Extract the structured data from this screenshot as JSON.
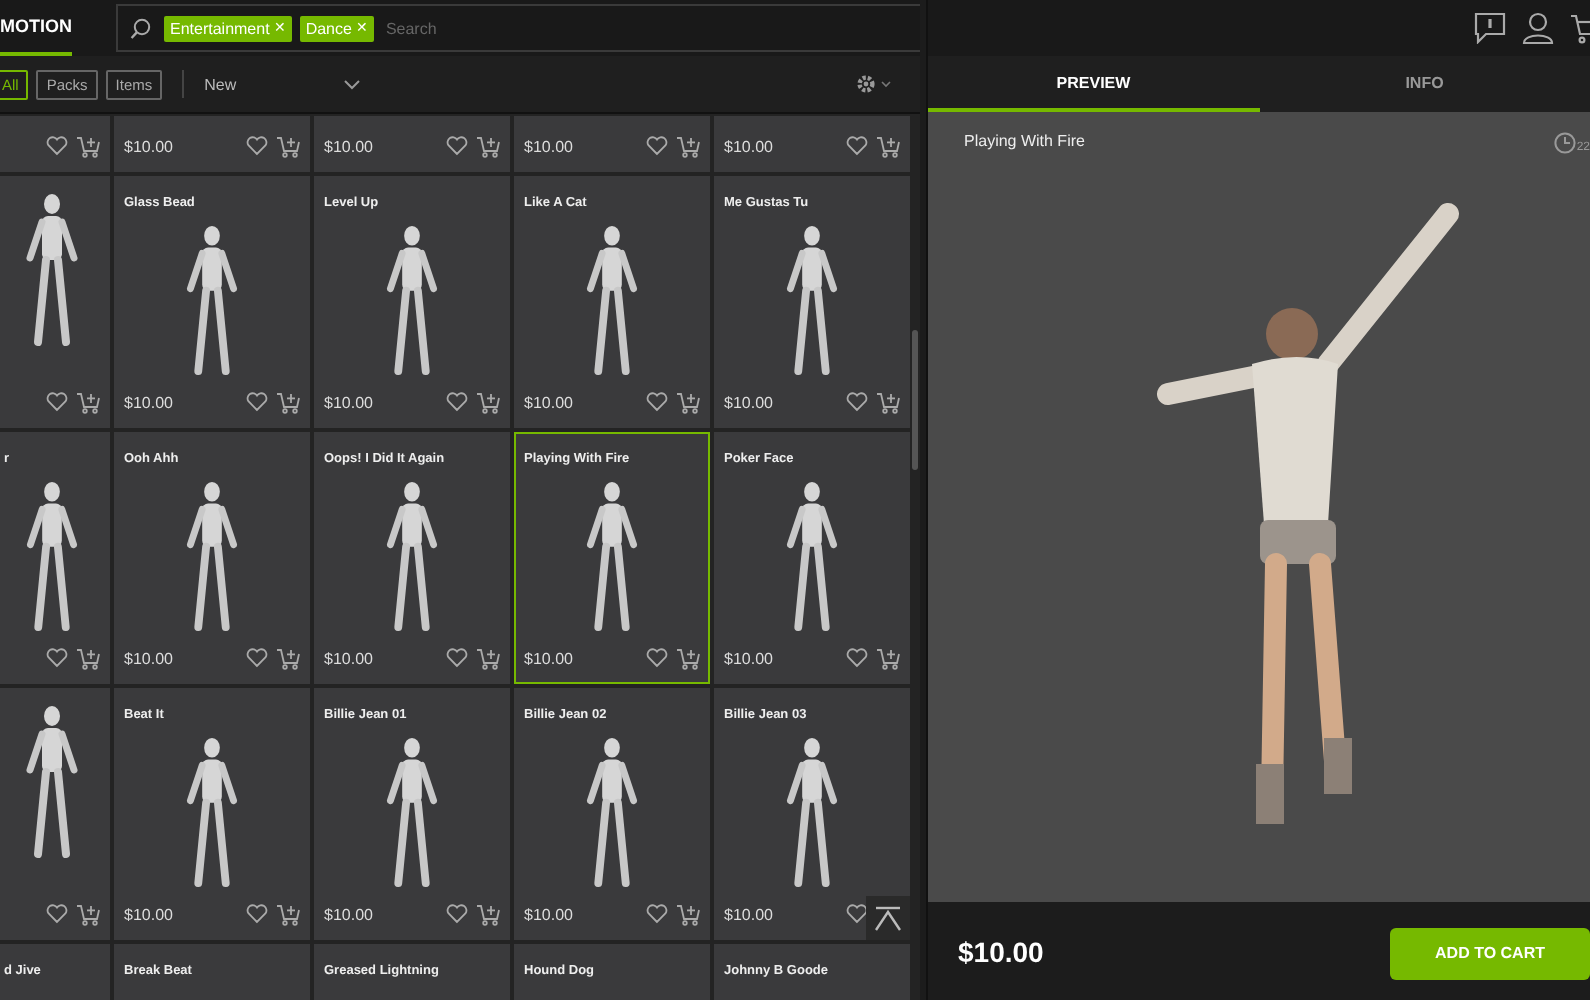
{
  "header": {
    "app_tab": "MOTION",
    "search": {
      "chips": [
        {
          "label": "Entertainment",
          "remove": "✕"
        },
        {
          "label": "Dance",
          "remove": "✕"
        }
      ],
      "placeholder": "Search"
    }
  },
  "toolbar": {
    "filters": [
      {
        "label": "All",
        "selected": true
      },
      {
        "label": "Packs",
        "selected": false
      },
      {
        "label": "Items",
        "selected": false
      }
    ],
    "sort": "New"
  },
  "grid": {
    "rows": [
      [
        {
          "selected": false
        },
        {
          "price": "$10.00",
          "selected": false
        },
        {
          "price": "$10.00",
          "selected": false
        },
        {
          "price": "$10.00",
          "selected": false
        },
        {
          "price": "$10.00",
          "selected": false
        }
      ],
      [
        {
          "selected": false
        },
        {
          "name": "Glass Bead",
          "price": "$10.00",
          "selected": false
        },
        {
          "name": "Level Up",
          "price": "$10.00",
          "selected": false
        },
        {
          "name": "Like A Cat",
          "price": "$10.00",
          "selected": false
        },
        {
          "name": "Me Gustas Tu",
          "price": "$10.00",
          "selected": false
        }
      ],
      [
        {
          "name": "r",
          "selected": false
        },
        {
          "name": "Ooh Ahh",
          "price": "$10.00",
          "selected": false
        },
        {
          "name": "Oops! I Did It Again",
          "price": "$10.00",
          "selected": false
        },
        {
          "name": "Playing With Fire",
          "price": "$10.00",
          "selected": true
        },
        {
          "name": "Poker Face",
          "price": "$10.00",
          "selected": false
        }
      ],
      [
        {
          "selected": false
        },
        {
          "name": "Beat It",
          "price": "$10.00",
          "selected": false
        },
        {
          "name": "Billie Jean 01",
          "price": "$10.00",
          "selected": false
        },
        {
          "name": "Billie Jean 02",
          "price": "$10.00",
          "selected": false
        },
        {
          "name": "Billie Jean 03",
          "price": "$10.00",
          "selected": false
        }
      ],
      [
        {
          "name": "d Jive",
          "selected": false
        },
        {
          "name": "Break Beat",
          "selected": false
        },
        {
          "name": "Greased Lightning",
          "selected": false
        },
        {
          "name": "Hound Dog",
          "selected": false
        },
        {
          "name": "Johnny B Goode",
          "selected": false
        }
      ]
    ]
  },
  "panel": {
    "tabs": [
      {
        "label": "PREVIEW",
        "selected": true
      },
      {
        "label": "INFO",
        "selected": false
      }
    ],
    "title": "Playing With Fire",
    "duration": "22",
    "price": "$10.00",
    "button": "ADD TO CART"
  }
}
